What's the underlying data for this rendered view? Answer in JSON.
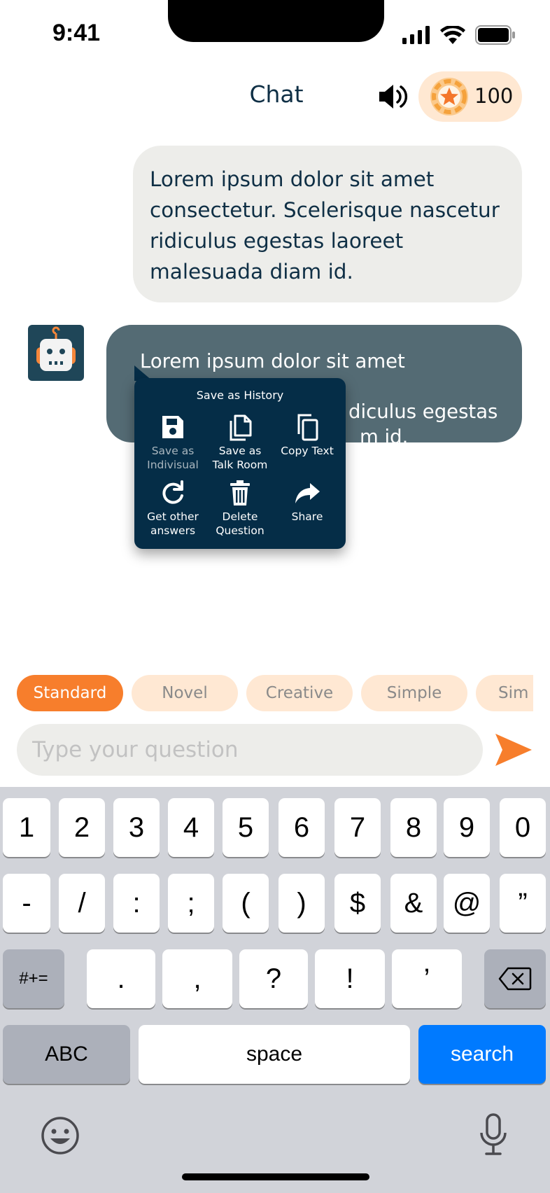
{
  "status_bar": {
    "time": "9:41"
  },
  "header": {
    "title": "Chat",
    "coins": "100"
  },
  "messages": {
    "user": "Lorem ipsum dolor sit amet consectetur. Scelerisque nascetur ridiculus egestas laoreet malesuada diam id.",
    "bot_line1": "Lorem ipsum dolor sit amet consectetur.",
    "bot_line2": "diculus egestas",
    "bot_line3": "m id."
  },
  "popup": {
    "title": "Save as History",
    "items": [
      {
        "label_1": "Save as",
        "label_2": "Indivisual",
        "icon": "floppy-disk-icon"
      },
      {
        "label_1": "Save as",
        "label_2": "Talk Room",
        "icon": "documents-icon"
      },
      {
        "label_1": "Copy Text",
        "label_2": "",
        "icon": "copy-icon"
      },
      {
        "label_1": "Get other",
        "label_2": "answers",
        "icon": "refresh-icon"
      },
      {
        "label_1": "Delete",
        "label_2": "Question",
        "icon": "trash-icon"
      },
      {
        "label_1": "Share",
        "label_2": "",
        "icon": "share-icon"
      }
    ]
  },
  "chips": [
    "Standard",
    "Novel",
    "Creative",
    "Simple",
    "Sim"
  ],
  "input": {
    "placeholder": "Type your question"
  },
  "keyboard": {
    "row1": [
      "1",
      "2",
      "3",
      "4",
      "5",
      "6",
      "7",
      "8",
      "9",
      "0"
    ],
    "row2": [
      "-",
      "/",
      ":",
      ";",
      "(",
      ")",
      "$",
      "&",
      "@",
      "”"
    ],
    "row3": [
      ".",
      ",",
      "?",
      "!",
      "’"
    ],
    "symbols": "#+=",
    "abc": "ABC",
    "space": "space",
    "action": "search"
  },
  "colors": {
    "accent": "#f77e2c",
    "navy": "#052d47",
    "key_blue": "#007aff"
  }
}
